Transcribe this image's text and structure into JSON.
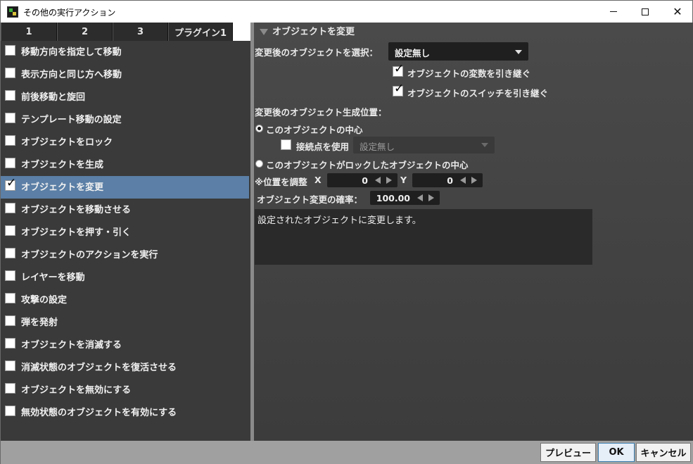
{
  "window": {
    "title": "その他の実行アクション",
    "app_icon": "game-editor-icon",
    "controls": {
      "minimize": "minimize-icon",
      "maximize": "maximize-icon",
      "close": "✕"
    }
  },
  "tabs": [
    {
      "label": "1"
    },
    {
      "label": "2"
    },
    {
      "label": "3"
    },
    {
      "label": "プラグイン1"
    }
  ],
  "actions": [
    {
      "label": "移動方向を指定して移動",
      "checked": false
    },
    {
      "label": "表示方向と同じ方へ移動",
      "checked": false
    },
    {
      "label": "前後移動と旋回",
      "checked": false
    },
    {
      "label": "テンプレート移動の設定",
      "checked": false
    },
    {
      "label": "オブジェクトをロック",
      "checked": false
    },
    {
      "label": "オブジェクトを生成",
      "checked": false
    },
    {
      "label": "オブジェクトを変更",
      "checked": true
    },
    {
      "label": "オブジェクトを移動させる",
      "checked": false
    },
    {
      "label": "オブジェクトを押す・引く",
      "checked": false
    },
    {
      "label": "オブジェクトのアクションを実行",
      "checked": false
    },
    {
      "label": "レイヤーを移動",
      "checked": false
    },
    {
      "label": "攻撃の設定",
      "checked": false
    },
    {
      "label": "弾を発射",
      "checked": false
    },
    {
      "label": "オブジェクトを消滅する",
      "checked": false
    },
    {
      "label": "消滅状態のオブジェクトを復活させる",
      "checked": false
    },
    {
      "label": "オブジェクトを無効にする",
      "checked": false
    },
    {
      "label": "無効状態のオブジェクトを有効にする",
      "checked": false
    }
  ],
  "detail": {
    "section_title": "オブジェクトを変更",
    "select_label": "変更後のオブジェクトを選択：",
    "select_value": "設定無し",
    "inherit_variables_label": "オブジェクトの変数を引き継ぐ",
    "inherit_variables_checked": true,
    "inherit_switches_label": "オブジェクトのスイッチを引き継ぐ",
    "inherit_switches_checked": true,
    "position_label": "変更後のオブジェクト生成位置：",
    "radio_center_label": "このオブジェクトの中心",
    "radio_center_selected": true,
    "use_connection_label": "接続点を使用",
    "use_connection_checked": false,
    "connection_value": "設定無し",
    "radio_locked_label": "このオブジェクトがロックしたオブジェクトの中心",
    "radio_locked_selected": false,
    "adjust_label": "※位置を調整",
    "x_label": "X",
    "x_value": "0",
    "y_label": "Y",
    "y_value": "0",
    "probability_label": "オブジェクト変更の確率：",
    "probability_value": "100.00",
    "description": "設定されたオブジェクトに変更します。"
  },
  "buttons": {
    "preview": "プレビュー",
    "ok": "OK",
    "cancel": "キャンセル"
  }
}
